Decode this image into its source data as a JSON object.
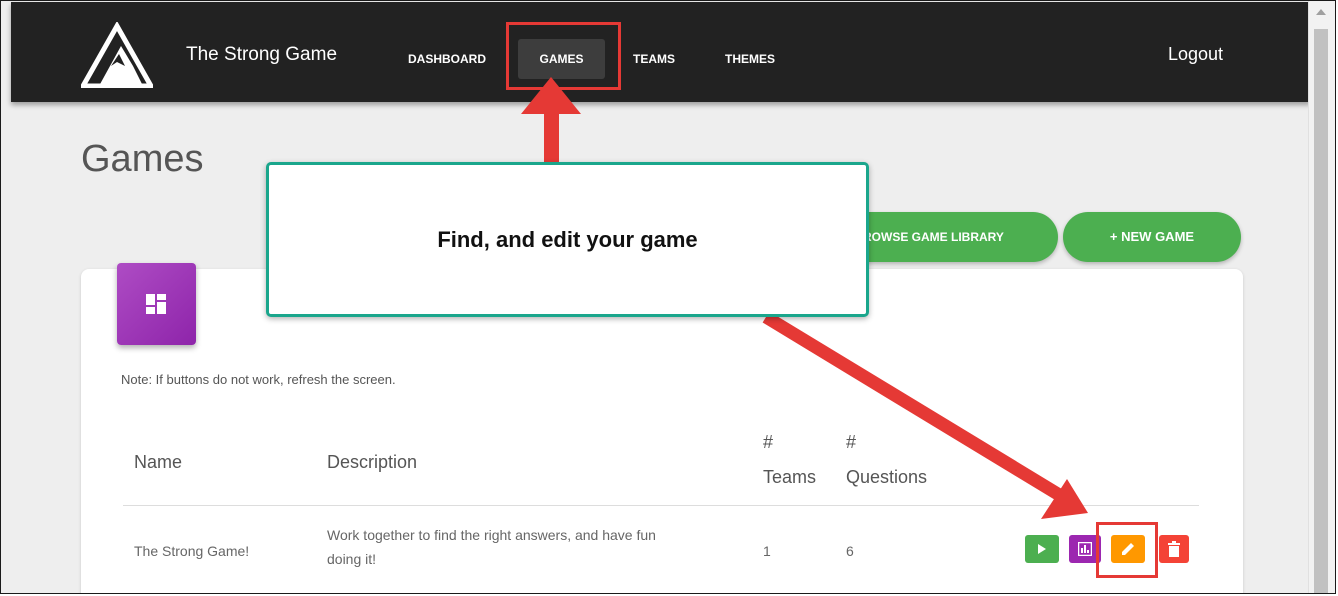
{
  "navbar": {
    "brand": "The Strong Game",
    "items": [
      "DASHBOARD",
      "GAMES",
      "TEAMS",
      "THEMES"
    ],
    "logout": "Logout"
  },
  "page": {
    "title": "Games",
    "browse_button": "ROWSE GAME LIBRARY",
    "new_game_button": "+ NEW GAME",
    "note": "Note: If buttons do not work, refresh the screen."
  },
  "table": {
    "headers": {
      "name": "Name",
      "description": "Description",
      "teams_hash": "#",
      "teams": "Teams",
      "questions_hash": "#",
      "questions": "Questions"
    },
    "rows": [
      {
        "name": "The Strong Game!",
        "description_line1": "Work together to find the right answers, and have fun",
        "description_line2": "doing it!",
        "teams": "1",
        "questions": "6"
      }
    ]
  },
  "callout": {
    "text": "Find, and edit your game"
  },
  "colors": {
    "navbar": "#222222",
    "accent_green": "#4caf50",
    "accent_purple": "#9c27b0",
    "accent_orange": "#ff9800",
    "accent_red": "#f44336",
    "annotation_red": "#e53935",
    "callout_border": "#1aa68c"
  },
  "icons": [
    "mountain-logo-icon",
    "dashboard-grid-icon",
    "play-icon",
    "chart-icon",
    "pencil-icon",
    "trash-icon",
    "plus-icon"
  ]
}
